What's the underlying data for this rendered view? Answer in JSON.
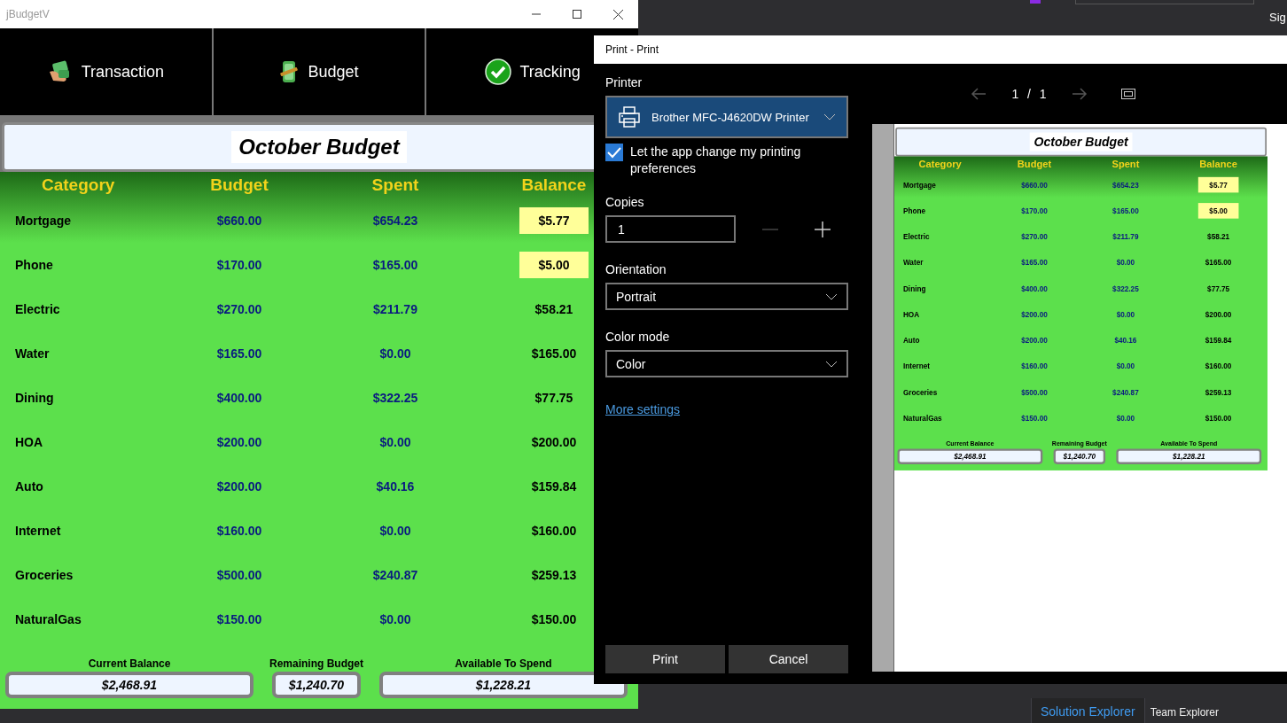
{
  "ide": {
    "account_label": "Sig",
    "panel_tabs": [
      {
        "label": "Solution Explorer",
        "selected": true
      },
      {
        "label": "Team Explorer",
        "selected": false
      }
    ]
  },
  "app_window": {
    "title": "jBudgetV",
    "tabs": [
      {
        "label": "Transaction",
        "kind": "cash"
      },
      {
        "label": "Budget",
        "kind": "bundle"
      },
      {
        "label": "Tracking",
        "kind": "check"
      }
    ]
  },
  "budget": {
    "title": "October Budget",
    "columns": [
      "Category",
      "Budget",
      "Spent",
      "Balance"
    ],
    "rows": [
      {
        "category": "Mortgage",
        "budget": "$660.00",
        "spent": "$654.23",
        "balance": "$5.77",
        "highlighted": true
      },
      {
        "category": "Phone",
        "budget": "$170.00",
        "spent": "$165.00",
        "balance": "$5.00",
        "highlighted": true
      },
      {
        "category": "Electric",
        "budget": "$270.00",
        "spent": "$211.79",
        "balance": "$58.21",
        "highlighted": false
      },
      {
        "category": "Water",
        "budget": "$165.00",
        "spent": "$0.00",
        "balance": "$165.00",
        "highlighted": false
      },
      {
        "category": "Dining",
        "budget": "$400.00",
        "spent": "$322.25",
        "balance": "$77.75",
        "highlighted": false
      },
      {
        "category": "HOA",
        "budget": "$200.00",
        "spent": "$0.00",
        "balance": "$200.00",
        "highlighted": false
      },
      {
        "category": "Auto",
        "budget": "$200.00",
        "spent": "$40.16",
        "balance": "$159.84",
        "highlighted": false
      },
      {
        "category": "Internet",
        "budget": "$160.00",
        "spent": "$0.00",
        "balance": "$160.00",
        "highlighted": false
      },
      {
        "category": "Groceries",
        "budget": "$500.00",
        "spent": "$240.87",
        "balance": "$259.13",
        "highlighted": false
      },
      {
        "category": "NaturalGas",
        "budget": "$150.00",
        "spent": "$0.00",
        "balance": "$150.00",
        "highlighted": false
      }
    ],
    "summary": [
      {
        "label": "Current Balance",
        "value": "$2,468.91"
      },
      {
        "label": "Remaining Budget",
        "value": "$1,240.70"
      },
      {
        "label": "Available To Spend",
        "value": "$1,228.21"
      }
    ]
  },
  "print_dialog": {
    "title": "Print - Print",
    "printer_label": "Printer",
    "printer": "Brother MFC-J4620DW Printer",
    "let_app_change": {
      "label": "Let the app change my printing preferences",
      "checked": true
    },
    "copies_label": "Copies",
    "copies": "1",
    "decrement_disabled": true,
    "increment_disabled": false,
    "orientation_label": "Orientation",
    "orientation": "Portrait",
    "color_mode_label": "Color mode",
    "color_mode": "Color",
    "more_settings": "More settings",
    "page_indicator": "1 / 1",
    "print_button": "Print",
    "cancel_button": "Cancel",
    "preview": {
      "title": "October Budget",
      "columns": [
        "Category",
        "Budget",
        "Spent",
        "Balance"
      ],
      "rows": [
        {
          "category": "Mortgage",
          "budget": "$660.00",
          "spent": "$654.23",
          "balance": "$5.77",
          "highlighted": true
        },
        {
          "category": "Phone",
          "budget": "$170.00",
          "spent": "$165.00",
          "balance": "$5.00",
          "highlighted": true
        },
        {
          "category": "Electric",
          "budget": "$270.00",
          "spent": "$211.79",
          "balance": "$58.21",
          "highlighted": false
        },
        {
          "category": "Water",
          "budget": "$165.00",
          "spent": "$0.00",
          "balance": "$165.00",
          "highlighted": false
        },
        {
          "category": "Dining",
          "budget": "$400.00",
          "spent": "$322.25",
          "balance": "$77.75",
          "highlighted": false
        },
        {
          "category": "HOA",
          "budget": "$200.00",
          "spent": "$0.00",
          "balance": "$200.00",
          "highlighted": false
        },
        {
          "category": "Auto",
          "budget": "$200.00",
          "spent": "$40.16",
          "balance": "$159.84",
          "highlighted": false
        },
        {
          "category": "Internet",
          "budget": "$160.00",
          "spent": "$0.00",
          "balance": "$160.00",
          "highlighted": false
        },
        {
          "category": "Groceries",
          "budget": "$500.00",
          "spent": "$240.87",
          "balance": "$259.13",
          "highlighted": false
        },
        {
          "category": "NaturalGas",
          "budget": "$150.00",
          "spent": "$0.00",
          "balance": "$150.00",
          "highlighted": false
        }
      ],
      "summary": [
        {
          "label": "Current Balance",
          "value": "$2,468.91"
        },
        {
          "label": "Remaining Budget",
          "value": "$1,240.70"
        },
        {
          "label": "Available To Spend",
          "value": "$1,228.21"
        }
      ]
    }
  }
}
